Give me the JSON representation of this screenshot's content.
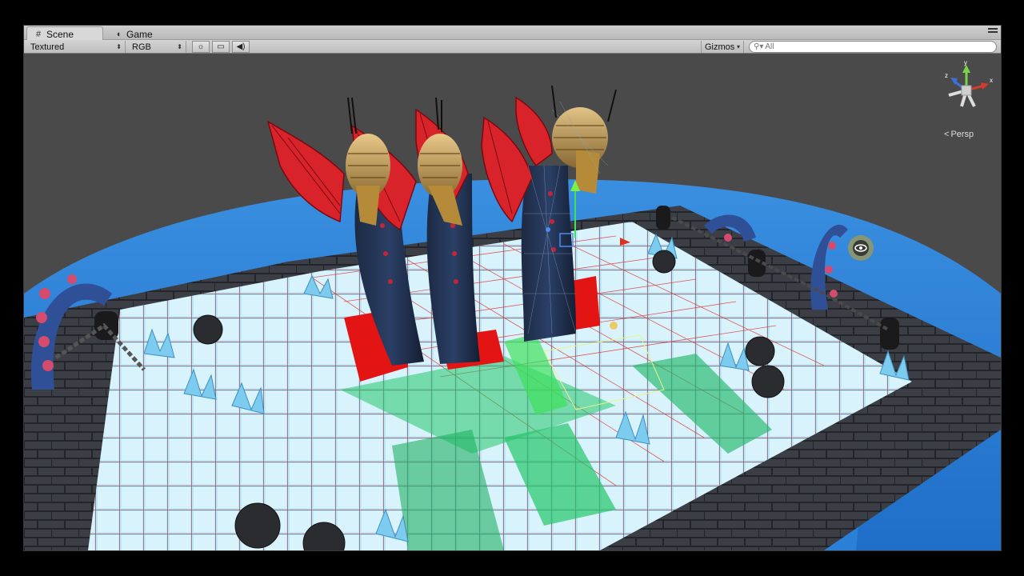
{
  "tabs": [
    {
      "label": "Scene",
      "icon": "grid-icon"
    },
    {
      "label": "Game",
      "icon": "pacman-icon"
    }
  ],
  "toolbar": {
    "render_mode": "Textured",
    "channel": "RGB",
    "gizmos": "Gizmos",
    "search_placeholder": "All"
  },
  "viewport": {
    "projection": "Persp",
    "axes": {
      "x": "x",
      "y": "y",
      "z": "z"
    }
  },
  "colors": {
    "water": "#2e82d8",
    "ice_tile": "#bde6f5",
    "stone": "#3c3f46",
    "dragon_wing": "#d8232a",
    "trigger_green": "#22c66a",
    "red_block": "#e21414"
  }
}
